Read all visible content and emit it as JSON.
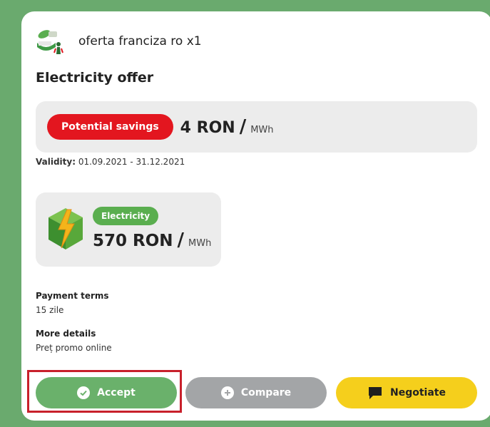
{
  "header": {
    "company_name": "oferta franciza ro x1",
    "logo_icon": "company-logo-icon"
  },
  "offer": {
    "title": "Electricity offer",
    "savings_label": "Potential savings",
    "savings_amount": "4 RON",
    "savings_unit": "MWh",
    "validity_label": "Validity:",
    "validity_value": "01.09.2021 - 31.12.2021"
  },
  "product": {
    "icon": "electricity-cube-icon",
    "badge": "Electricity",
    "price": "570 RON",
    "unit": "MWh"
  },
  "terms": {
    "payment_label": "Payment terms",
    "payment_value": "15 zile",
    "details_label": "More details",
    "details_value": "Preț promo online"
  },
  "actions": {
    "accept": "Accept",
    "compare": "Compare",
    "negotiate": "Negotiate"
  },
  "colors": {
    "background": "#6aaa6e",
    "savings_pill": "#e3161f",
    "electricity_badge": "#5aae4f",
    "accept": "#6ab16b",
    "compare": "#a3a5a7",
    "negotiate": "#f5cf1c",
    "highlight": "#c8202b"
  }
}
